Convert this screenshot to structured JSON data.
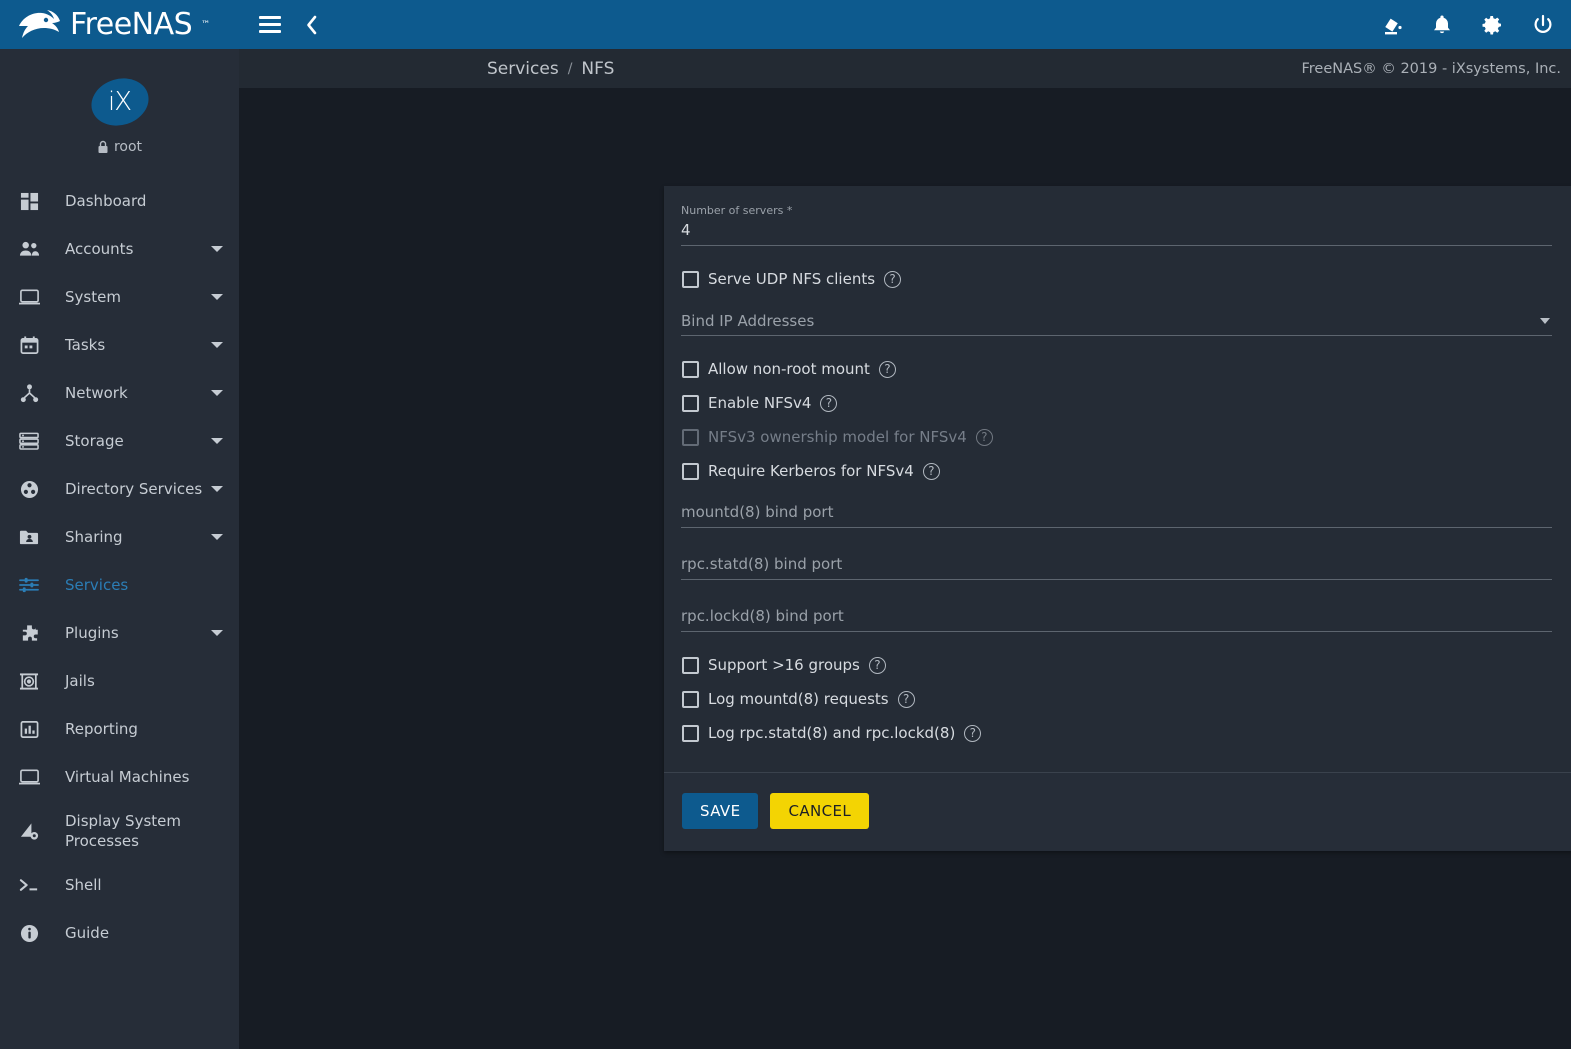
{
  "brand": {
    "name": "FreeNAS",
    "trademark": "™",
    "logo_icon": "freenas-fish-logo"
  },
  "sidebar": {
    "avatar_text": "iX",
    "user_name": "root",
    "lock_icon": "lock-icon",
    "items": [
      {
        "label": "Dashboard",
        "icon": "dashboard-icon",
        "expandable": false,
        "active": false
      },
      {
        "label": "Accounts",
        "icon": "accounts-users-icon",
        "expandable": true,
        "active": false
      },
      {
        "label": "System",
        "icon": "system-monitor-icon",
        "expandable": true,
        "active": false
      },
      {
        "label": "Tasks",
        "icon": "tasks-calendar-icon",
        "expandable": true,
        "active": false
      },
      {
        "label": "Network",
        "icon": "network-nodes-icon",
        "expandable": true,
        "active": false
      },
      {
        "label": "Storage",
        "icon": "storage-disks-icon",
        "expandable": true,
        "active": false
      },
      {
        "label": "Directory Services",
        "icon": "directory-services-icon",
        "expandable": true,
        "active": false
      },
      {
        "label": "Sharing",
        "icon": "sharing-folder-icon",
        "expandable": true,
        "active": false
      },
      {
        "label": "Services",
        "icon": "services-sliders-icon",
        "expandable": false,
        "active": true
      },
      {
        "label": "Plugins",
        "icon": "plugins-puzzle-icon",
        "expandable": true,
        "active": false
      },
      {
        "label": "Jails",
        "icon": "jails-icon",
        "expandable": false,
        "active": false
      },
      {
        "label": "Reporting",
        "icon": "reporting-chart-icon",
        "expandable": false,
        "active": false
      },
      {
        "label": "Virtual Machines",
        "icon": "virtual-machines-icon",
        "expandable": false,
        "active": false
      },
      {
        "label": "Display System Processes",
        "icon": "display-system-processes-icon",
        "expandable": false,
        "active": false
      },
      {
        "label": "Shell",
        "icon": "shell-terminal-icon",
        "expandable": false,
        "active": false
      },
      {
        "label": "Guide",
        "icon": "guide-info-icon",
        "expandable": false,
        "active": false
      }
    ]
  },
  "topbar": {
    "menu_icon": "hamburger-menu-icon",
    "back_icon": "chevron-left-icon",
    "right_icons": [
      {
        "name": "theme-paint-icon"
      },
      {
        "name": "notifications-bell-icon"
      },
      {
        "name": "settings-gear-icon"
      },
      {
        "name": "power-icon"
      }
    ]
  },
  "breadcrumb": {
    "root": "Services",
    "separator": "/",
    "current": "NFS"
  },
  "copyright": "FreeNAS® © 2019 - iXsystems, Inc.",
  "form": {
    "number_of_servers": {
      "label": "Number of servers *",
      "value": "4",
      "help_icon": "help-circle-icon"
    },
    "serve_udp": {
      "label": "Serve UDP NFS clients",
      "checked": false,
      "disabled": false,
      "help_icon": "help-circle-icon"
    },
    "bind_ip": {
      "label": "Bind IP Addresses",
      "value": "",
      "caret_icon": "chevron-down-icon",
      "help_icon": "help-circle-icon"
    },
    "allow_non_root": {
      "label": "Allow non-root mount",
      "checked": false,
      "disabled": false,
      "help_icon": "help-circle-icon"
    },
    "enable_nfsv4": {
      "label": "Enable NFSv4",
      "checked": false,
      "disabled": false,
      "help_icon": "help-circle-icon"
    },
    "nfsv3_ownership": {
      "label": "NFSv3 ownership model for NFSv4",
      "checked": false,
      "disabled": true,
      "help_icon": "help-circle-icon"
    },
    "require_kerberos": {
      "label": "Require Kerberos for NFSv4",
      "checked": false,
      "disabled": false,
      "help_icon": "help-circle-icon"
    },
    "mountd_port": {
      "label": "mountd(8) bind port",
      "value": "",
      "help_icon": "help-circle-icon"
    },
    "rpc_statd_port": {
      "label": "rpc.statd(8) bind port",
      "value": "",
      "help_icon": "help-circle-icon"
    },
    "rpc_lockd_port": {
      "label": "rpc.lockd(8) bind port",
      "value": "",
      "help_icon": "help-circle-icon"
    },
    "support_16_groups": {
      "label": "Support >16 groups",
      "checked": false,
      "disabled": false,
      "help_icon": "help-circle-icon"
    },
    "log_mountd": {
      "label": "Log mountd(8) requests",
      "checked": false,
      "disabled": false,
      "help_icon": "help-circle-icon"
    },
    "log_rpc": {
      "label": "Log rpc.statd(8) and rpc.lockd(8)",
      "checked": false,
      "disabled": false,
      "help_icon": "help-circle-icon"
    },
    "save_label": "SAVE",
    "cancel_label": "CANCEL"
  },
  "colors": {
    "brand_blue": "#0d5a8e",
    "sidebar_bg": "#262d38",
    "page_bg": "#171c24",
    "card_bg": "#252c36",
    "accent_active": "#2b7db5",
    "cancel_yellow": "#f3d403"
  }
}
